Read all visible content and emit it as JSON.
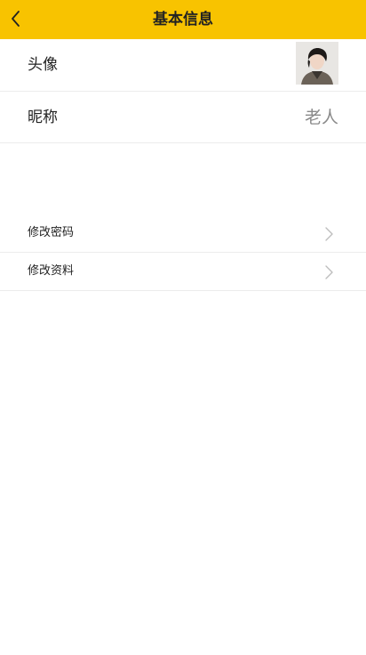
{
  "header": {
    "title": "基本信息",
    "back_icon": "chevron-left-icon",
    "background_color": "#f8c300"
  },
  "profile": {
    "avatar_label": "头像",
    "nickname_label": "昵称",
    "nickname_value": "老人"
  },
  "menu": {
    "items": [
      {
        "label": "修改密码",
        "icon": "chevron-right-icon"
      },
      {
        "label": "修改资料",
        "icon": "chevron-right-icon"
      }
    ]
  }
}
